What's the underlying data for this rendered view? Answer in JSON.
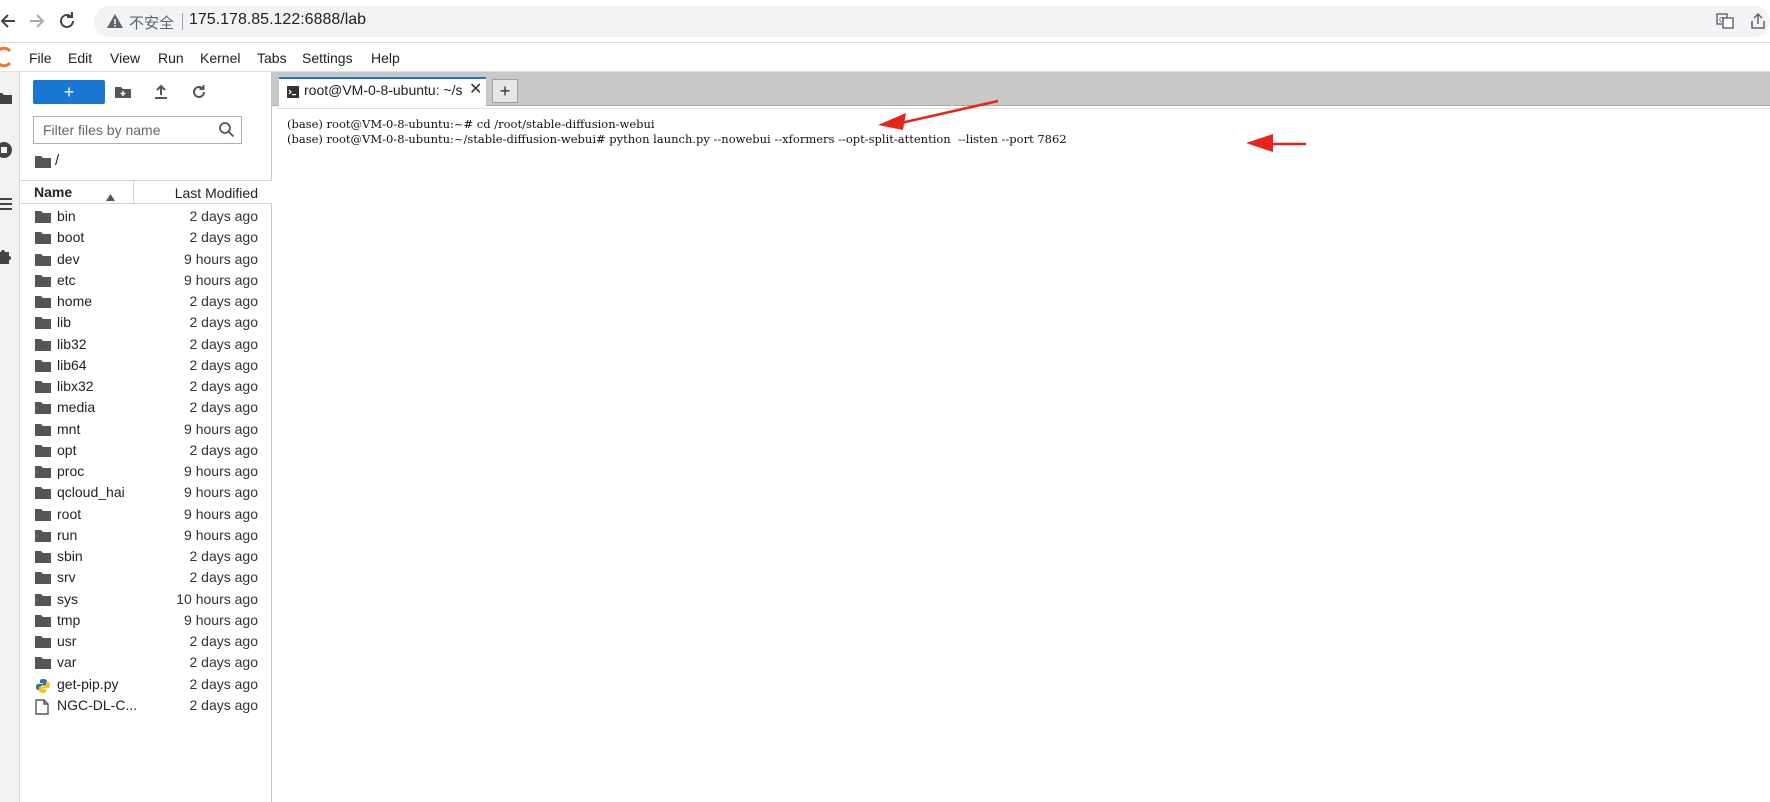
{
  "browser": {
    "back_icon": "back-arrow-icon",
    "forward_icon": "forward-arrow-icon",
    "reload_icon": "reload-icon",
    "security_label": "不安全",
    "url": "175.178.85.122:6888/lab"
  },
  "menu": [
    "File",
    "Edit",
    "View",
    "Run",
    "Kernel",
    "Tabs",
    "Settings",
    "Help"
  ],
  "file_browser": {
    "new_button_label": "+",
    "filter_placeholder": "Filter files by name",
    "breadcrumb": "/",
    "columns": {
      "name": "Name",
      "modified": "Last Modified"
    },
    "files": [
      {
        "name": "bin",
        "modified": "2 days ago",
        "icon": "folder-icon"
      },
      {
        "name": "boot",
        "modified": "2 days ago",
        "icon": "folder-icon"
      },
      {
        "name": "dev",
        "modified": "9 hours ago",
        "icon": "folder-icon"
      },
      {
        "name": "etc",
        "modified": "9 hours ago",
        "icon": "folder-icon"
      },
      {
        "name": "home",
        "modified": "2 days ago",
        "icon": "folder-icon"
      },
      {
        "name": "lib",
        "modified": "2 days ago",
        "icon": "folder-icon"
      },
      {
        "name": "lib32",
        "modified": "2 days ago",
        "icon": "folder-icon"
      },
      {
        "name": "lib64",
        "modified": "2 days ago",
        "icon": "folder-icon"
      },
      {
        "name": "libx32",
        "modified": "2 days ago",
        "icon": "folder-icon"
      },
      {
        "name": "media",
        "modified": "2 days ago",
        "icon": "folder-icon"
      },
      {
        "name": "mnt",
        "modified": "9 hours ago",
        "icon": "folder-icon"
      },
      {
        "name": "opt",
        "modified": "2 days ago",
        "icon": "folder-icon"
      },
      {
        "name": "proc",
        "modified": "9 hours ago",
        "icon": "folder-icon"
      },
      {
        "name": "qcloud_hai",
        "modified": "9 hours ago",
        "icon": "folder-icon"
      },
      {
        "name": "root",
        "modified": "9 hours ago",
        "icon": "folder-icon"
      },
      {
        "name": "run",
        "modified": "9 hours ago",
        "icon": "folder-icon"
      },
      {
        "name": "sbin",
        "modified": "2 days ago",
        "icon": "folder-icon"
      },
      {
        "name": "srv",
        "modified": "2 days ago",
        "icon": "folder-icon"
      },
      {
        "name": "sys",
        "modified": "10 hours ago",
        "icon": "folder-icon"
      },
      {
        "name": "tmp",
        "modified": "9 hours ago",
        "icon": "folder-icon"
      },
      {
        "name": "usr",
        "modified": "2 days ago",
        "icon": "folder-icon"
      },
      {
        "name": "var",
        "modified": "2 days ago",
        "icon": "folder-icon"
      },
      {
        "name": "get-pip.py",
        "modified": "2 days ago",
        "icon": "python-file-icon"
      },
      {
        "name": "NGC-DL-C...",
        "modified": "2 days ago",
        "icon": "file-icon"
      }
    ]
  },
  "tabs": [
    {
      "label": "root@VM-0-8-ubuntu: ~/s",
      "icon": "terminal-icon",
      "active": true
    }
  ],
  "add_tab_label": "+",
  "terminal": {
    "lines": [
      "(base) root@VM-0-8-ubuntu:~# cd /root/stable-diffusion-webui",
      "(base) root@VM-0-8-ubuntu:~/stable-diffusion-webui# python launch.py --nowebui --xformers --opt-split-attention  --listen --port 7862"
    ]
  },
  "annotation_color": "#e8231c",
  "accent_color": "#1976d2"
}
